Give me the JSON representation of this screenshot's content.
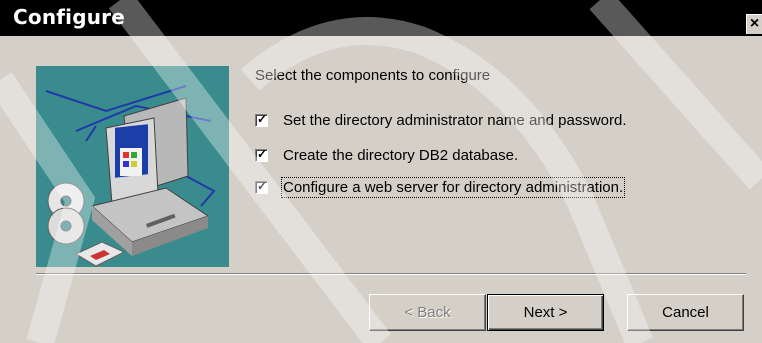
{
  "window": {
    "title": "Configure",
    "close_label": "×"
  },
  "main": {
    "prompt": "Select the components to configure",
    "options": [
      {
        "label": "Set the directory administrator name and password.",
        "checked": true
      },
      {
        "label": "Create the directory DB2 database.",
        "checked": true
      },
      {
        "label": "Configure a web server for directory administration.",
        "checked": true,
        "focused": true
      }
    ],
    "check_mark": "✓"
  },
  "footer": {
    "back_label": "< Back",
    "next_label": "Next >",
    "cancel_label": "Cancel"
  },
  "colors": {
    "dialog_bg": "#d4d0c8",
    "illustration_bg": "#3a8b8d",
    "title_bar": "#000000"
  }
}
